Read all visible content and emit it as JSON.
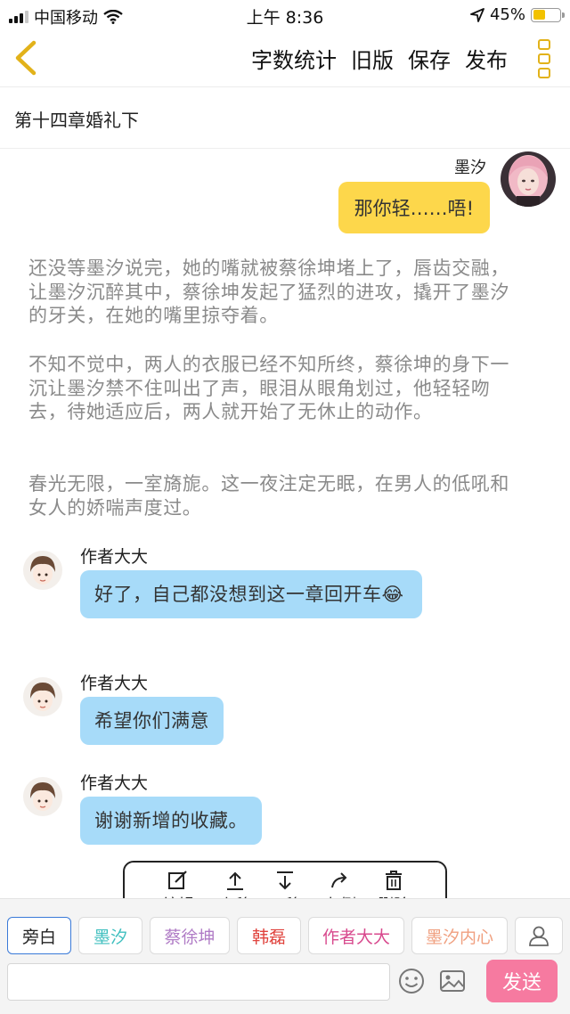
{
  "status_bar": {
    "carrier": "中国移动",
    "time": "上午 8:36",
    "battery_percent": "45%",
    "battery_level": 0.45,
    "icons": [
      "signal-icon",
      "wifi-icon",
      "location-arrow-icon",
      "battery-icon"
    ]
  },
  "nav": {
    "back_icon": "chevron-left-icon",
    "actions": {
      "word_count": "字数统计",
      "old_version": "旧版",
      "save": "保存",
      "publish": "发布"
    },
    "more_icon": "more-vertical-icon",
    "accent_color": "#e2b21a"
  },
  "chapter": {
    "title": "第十四章婚礼下"
  },
  "messages": {
    "moxi": {
      "name": "墨汐",
      "text": "那你轻……唔!",
      "bubble_color": "#fdd74b"
    },
    "narration": [
      "还没等墨汐说完，她的嘴就被蔡徐坤堵上了，唇齿交融，让墨汐沉醉其中，蔡徐坤发起了猛烈的进攻，撬开了墨汐的牙关，在她的嘴里掠夺着。",
      "不知不觉中，两人的衣服已经不知所终，蔡徐坤的身下一沉让墨汐禁不住叫出了声，眼泪从眼角划过，他轻轻吻去，待她适应后，两人就开始了无休止的动作。",
      "春光无限，一室旖旎。这一夜注定无眠，在男人的低吼和女人的娇喘声度过。"
    ],
    "author": [
      {
        "name": "作者大大",
        "text": "好了，自己都没想到这一章回开车😂"
      },
      {
        "name": "作者大大",
        "text": "希望你们满意"
      },
      {
        "name": "作者大大",
        "text": "谢谢新增的收藏。"
      }
    ],
    "author_bubble_color": "#a7dbf9"
  },
  "edit_toolbar": {
    "edit": "编辑",
    "move_up": "上移",
    "move_down": "下移",
    "side": "左侧",
    "delete": "删除"
  },
  "characters": {
    "chips": [
      {
        "label": "旁白",
        "color": "#222222"
      },
      {
        "label": "墨汐",
        "color": "#3fbfbf"
      },
      {
        "label": "蔡徐坤",
        "color": "#b07cc6"
      },
      {
        "label": "韩磊",
        "color": "#e0443e"
      },
      {
        "label": "作者大大",
        "color": "#d84a8e"
      },
      {
        "label": "墨汐内心",
        "color": "#f0a080"
      }
    ],
    "add_icon": "user-icon"
  },
  "composer": {
    "input_value": "",
    "emoji_icon": "smiley-icon",
    "image_icon": "image-icon",
    "send_label": "发送",
    "send_color": "#f67aa0"
  }
}
